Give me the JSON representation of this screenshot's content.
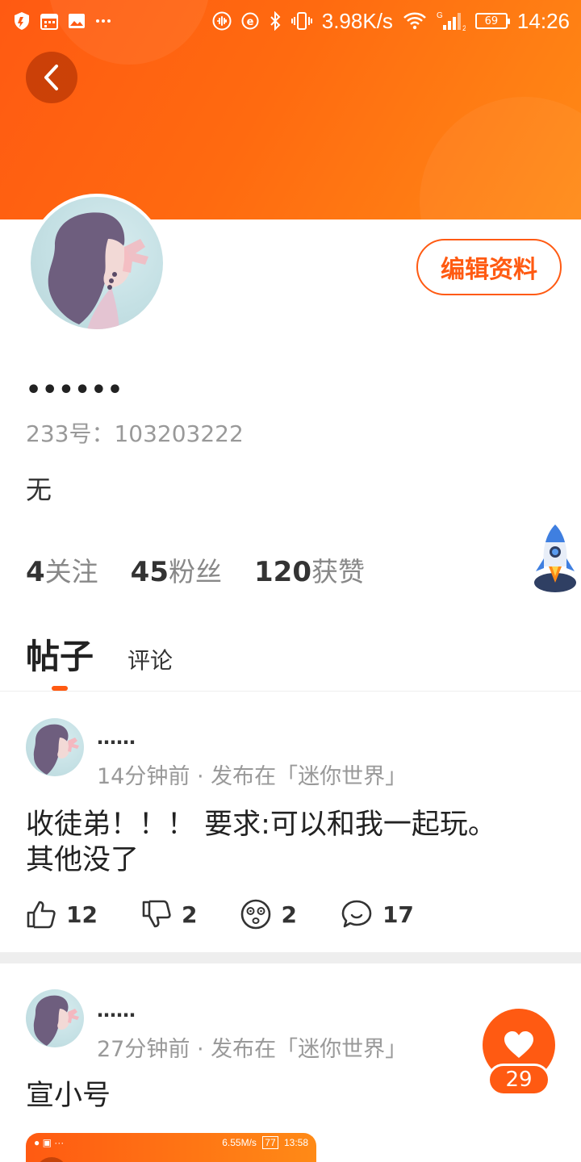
{
  "status_bar": {
    "net_speed": "3.98K/s",
    "signal_tag": "G",
    "battery": "69",
    "time": "14:26"
  },
  "profile": {
    "edit_label": "编辑资料",
    "nickname": "••••••",
    "uid": "233号：103203222",
    "bio": "无",
    "stats": [
      {
        "num": "4",
        "label": "关注"
      },
      {
        "num": "45",
        "label": "粉丝"
      },
      {
        "num": "120",
        "label": "获赞"
      }
    ]
  },
  "tabs": {
    "active": "帖子",
    "other": "评论"
  },
  "posts": [
    {
      "name": "……",
      "meta": "14分钟前 · 发布在「迷你世界」",
      "body_line1": "收徒弟！！！ 要求:可以和我一起玩。",
      "body_line2": "其他没了",
      "likes": "12",
      "dislikes": "2",
      "reactions": "2",
      "comments": "17"
    },
    {
      "name": "……",
      "meta": "27分钟前 · 发布在「迷你世界」",
      "body_line1": "宣小号"
    }
  ],
  "float_like": {
    "count": "29"
  },
  "preview": {
    "net_speed": "6.55M/s",
    "battery": "77",
    "time": "13:58"
  },
  "colors": {
    "accent": "#ff5a12",
    "banner_end": "#ff8a16",
    "separator": "#eeeeee"
  }
}
